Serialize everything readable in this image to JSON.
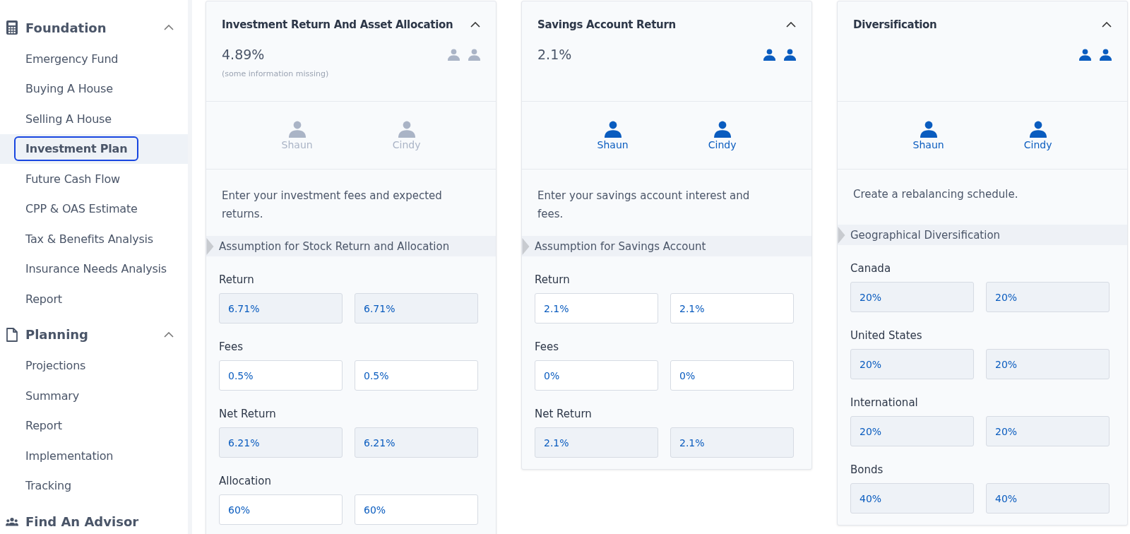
{
  "sidebar": {
    "sections": [
      {
        "kind": "calculator",
        "label": "Foundation",
        "expanded": true,
        "items": [
          {
            "label": "Emergency Fund",
            "selected": false,
            "annotated": false
          },
          {
            "label": "Buying A House",
            "selected": false,
            "annotated": false
          },
          {
            "label": "Selling A House",
            "selected": false,
            "annotated": false
          },
          {
            "label": "Investment Plan",
            "selected": true,
            "annotated": true
          },
          {
            "label": "Future Cash Flow",
            "selected": false,
            "annotated": false
          },
          {
            "label": "CPP & OAS Estimate",
            "selected": false,
            "annotated": false
          },
          {
            "label": "Tax & Benefits Analysis",
            "selected": false,
            "annotated": false
          },
          {
            "label": "Insurance Needs Analysis",
            "selected": false,
            "annotated": false
          },
          {
            "label": "Report",
            "selected": false,
            "annotated": false
          }
        ]
      },
      {
        "kind": "document",
        "label": "Planning",
        "expanded": true,
        "items": [
          {
            "label": "Projections",
            "selected": false,
            "annotated": false
          },
          {
            "label": "Summary",
            "selected": false,
            "annotated": false
          },
          {
            "label": "Report",
            "selected": false,
            "annotated": false
          },
          {
            "label": "Implementation",
            "selected": false,
            "annotated": false
          },
          {
            "label": "Tracking",
            "selected": false,
            "annotated": false
          }
        ]
      },
      {
        "kind": "people",
        "label": "Find An Advisor",
        "expanded": false
      }
    ]
  },
  "cards": [
    {
      "title": "Investment Return And Asset Allocation",
      "expanded": true,
      "value": "4.89%",
      "note": "(some information missing)",
      "people": [
        {
          "name": "Shaun",
          "active": false
        },
        {
          "name": "Cindy",
          "active": false
        }
      ],
      "description": "Enter your investment fees and expected returns.",
      "section": "Assumption for Stock Return and Allocation",
      "rows": [
        {
          "label": "Return",
          "fields": [
            {
              "value": "6.71%",
              "editable": false
            },
            {
              "value": "6.71%",
              "editable": false
            }
          ]
        },
        {
          "label": "Fees",
          "fields": [
            {
              "value": "0.5%",
              "editable": true
            },
            {
              "value": "0.5%",
              "editable": true
            }
          ]
        },
        {
          "label": "Net Return",
          "fields": [
            {
              "value": "6.21%",
              "editable": false
            },
            {
              "value": "6.21%",
              "editable": false
            }
          ]
        },
        {
          "label": "Allocation",
          "fields": [
            {
              "value": "60%",
              "editable": true
            },
            {
              "value": "60%",
              "editable": true
            }
          ]
        }
      ]
    },
    {
      "title": "Savings Account Return",
      "expanded": true,
      "value": "2.1%",
      "people": [
        {
          "name": "Shaun",
          "active": true
        },
        {
          "name": "Cindy",
          "active": true
        }
      ],
      "description": "Enter your savings account interest and fees.",
      "section": "Assumption for Savings Account",
      "rows": [
        {
          "label": "Return",
          "fields": [
            {
              "value": "2.1%",
              "editable": true
            },
            {
              "value": "2.1%",
              "editable": true
            }
          ]
        },
        {
          "label": "Fees",
          "fields": [
            {
              "value": "0%",
              "editable": true
            },
            {
              "value": "0%",
              "editable": true
            }
          ]
        },
        {
          "label": "Net Return",
          "fields": [
            {
              "value": "2.1%",
              "editable": false
            },
            {
              "value": "2.1%",
              "editable": false
            }
          ]
        }
      ]
    },
    {
      "title": "Diversification",
      "expanded": true,
      "people": [
        {
          "name": "Shaun",
          "active": true
        },
        {
          "name": "Cindy",
          "active": true
        }
      ],
      "description": "Create a rebalancing schedule.",
      "section": "Geographical Diversification",
      "rows": [
        {
          "label": "Canada",
          "fields": [
            {
              "value": "20%",
              "editable": false
            },
            {
              "value": "20%",
              "editable": false
            }
          ]
        },
        {
          "label": "United States",
          "fields": [
            {
              "value": "20%",
              "editable": false
            },
            {
              "value": "20%",
              "editable": false
            }
          ]
        },
        {
          "label": "International",
          "fields": [
            {
              "value": "20%",
              "editable": false
            },
            {
              "value": "20%",
              "editable": false
            }
          ]
        },
        {
          "label": "Bonds",
          "fields": [
            {
              "value": "40%",
              "editable": false
            },
            {
              "value": "40%",
              "editable": false
            }
          ]
        }
      ]
    }
  ]
}
